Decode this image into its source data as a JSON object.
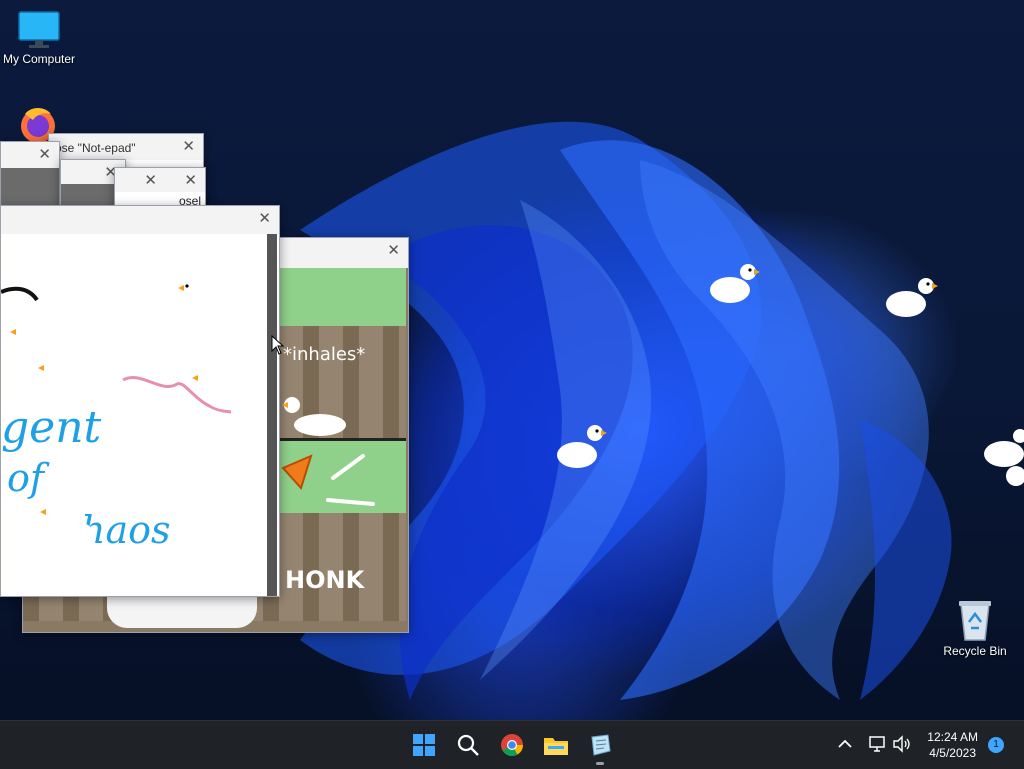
{
  "desktop": {
    "icons": [
      {
        "label": "My Computer",
        "icon": "monitor-icon"
      },
      {
        "label": "",
        "icon": "firefox-icon"
      },
      {
        "label": "Recycle Bin",
        "icon": "recycle-bin-icon"
      }
    ]
  },
  "windows": {
    "notepad_title": "ose \"Not-epad\"",
    "notepad_fragment": "osel",
    "close_glyph": "✕"
  },
  "memes": {
    "inhales": "*inhales*",
    "honk": "HONK"
  },
  "drawing": {
    "line1": "gent",
    "line2": "of",
    "line3": "haos"
  },
  "taskbar": {
    "apps": [
      "start-icon",
      "search-icon",
      "chrome-icon",
      "file-explorer-icon",
      "notepad-icon"
    ],
    "time": "12:24 AM",
    "date": "4/5/2023",
    "notification_count": "1"
  },
  "colors": {
    "taskbar": "#1f2327",
    "accent": "#0078d4",
    "meme_green": "#8fd18a",
    "crate_brown": "#8b7a63"
  }
}
